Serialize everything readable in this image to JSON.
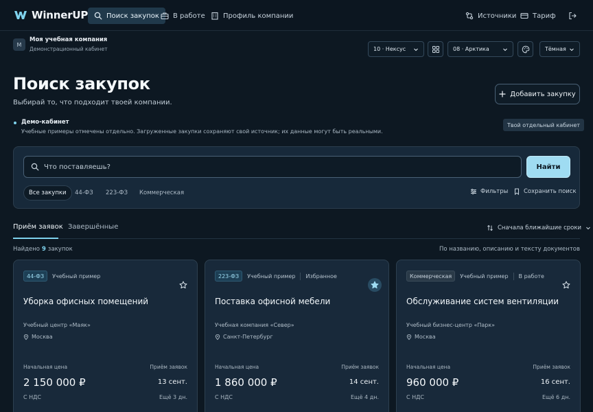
{
  "app": {
    "name": "WinnerUP",
    "brand_color": "#7fd3ee",
    "logo_icon": "w-logo-icon"
  },
  "nav": {
    "items": [
      {
        "label": "Поиск закупок",
        "icon": "search-icon",
        "active": true
      },
      {
        "label": "В работе",
        "icon": "briefcase-icon",
        "active": false
      },
      {
        "label": "Профиль компании",
        "icon": "building-icon",
        "active": false
      }
    ],
    "right": [
      {
        "label": "Источники",
        "icon": "sources-icon"
      },
      {
        "label": "Тариф",
        "icon": "card-icon"
      }
    ],
    "logout_icon": "logout-icon"
  },
  "company": {
    "avatar_letter": "М",
    "name": "Моя учебная компания",
    "subtitle": "Демонстрационный кабинет"
  },
  "controls": {
    "profile_select": "10 · Нексус",
    "grid_icon": "grid-icon",
    "org_select": "08 · Арктика",
    "palette_icon": "palette-icon",
    "theme_select": "Тёмная"
  },
  "page": {
    "title": "Поиск закупок",
    "subtitle": "Выбирай то, что подходит твоей компании.",
    "add_button": "Добавить закупку"
  },
  "demo": {
    "title": "Демо-кабинет",
    "text": "Учебные примеры отмечены отдельно. Загруженные закупки сохраняют свой источник; их данные могут быть реальными.",
    "badge": "Твой отдельный кабинет"
  },
  "search": {
    "placeholder": "Что поставляешь?",
    "value": "",
    "button": "Найти",
    "law_tabs": [
      {
        "label": "Все закупки",
        "active": true
      },
      {
        "label": "44-ФЗ",
        "active": false
      },
      {
        "label": "223-ФЗ",
        "active": false
      },
      {
        "label": "Коммерческая",
        "active": false
      }
    ],
    "filters_label": "Фильтры",
    "save_label": "Сохранить поиск"
  },
  "status_tabs": [
    {
      "label": "Приём заявок",
      "active": true
    },
    {
      "label": "Завершённые",
      "active": false
    }
  ],
  "sort": {
    "label": "Сначала ближайшие сроки"
  },
  "results": {
    "found_prefix": "Найдено",
    "count": "9",
    "found_suffix": "закупок",
    "hint": "По названию, описанию и тексту документов"
  },
  "card_labels": {
    "price": "Начальная цена",
    "deadline": "Приём заявок",
    "vat": "С НДС"
  },
  "cards": [
    {
      "law": "44-ФЗ",
      "law_style": "fz",
      "tags": [
        "Учебный пример"
      ],
      "favorite": false,
      "title": "Уборка офисных помещений",
      "customer": "Учебный центр «Маяк»",
      "city": "Москва",
      "price": "2 150 000 ₽",
      "deadline": "13 сент.",
      "days_left": "Ещё 3 дн."
    },
    {
      "law": "223-ФЗ",
      "law_style": "fz",
      "tags": [
        "Учебный пример",
        "Избранное"
      ],
      "favorite": true,
      "title": "Поставка офисной мебели",
      "customer": "Учебная компания «Север»",
      "city": "Санкт-Петербург",
      "price": "1 860 000 ₽",
      "deadline": "14 сент.",
      "days_left": "Ещё 4 дн."
    },
    {
      "law": "Коммерческая",
      "law_style": "com",
      "tags": [
        "Учебный пример",
        "В работе"
      ],
      "favorite": false,
      "title": "Обслуживание систем вентиляции",
      "customer": "Учебный бизнес-центр «Парк»",
      "city": "Москва",
      "price": "960 000 ₽",
      "deadline": "16 сент.",
      "days_left": "Ещё 6 дн."
    }
  ]
}
